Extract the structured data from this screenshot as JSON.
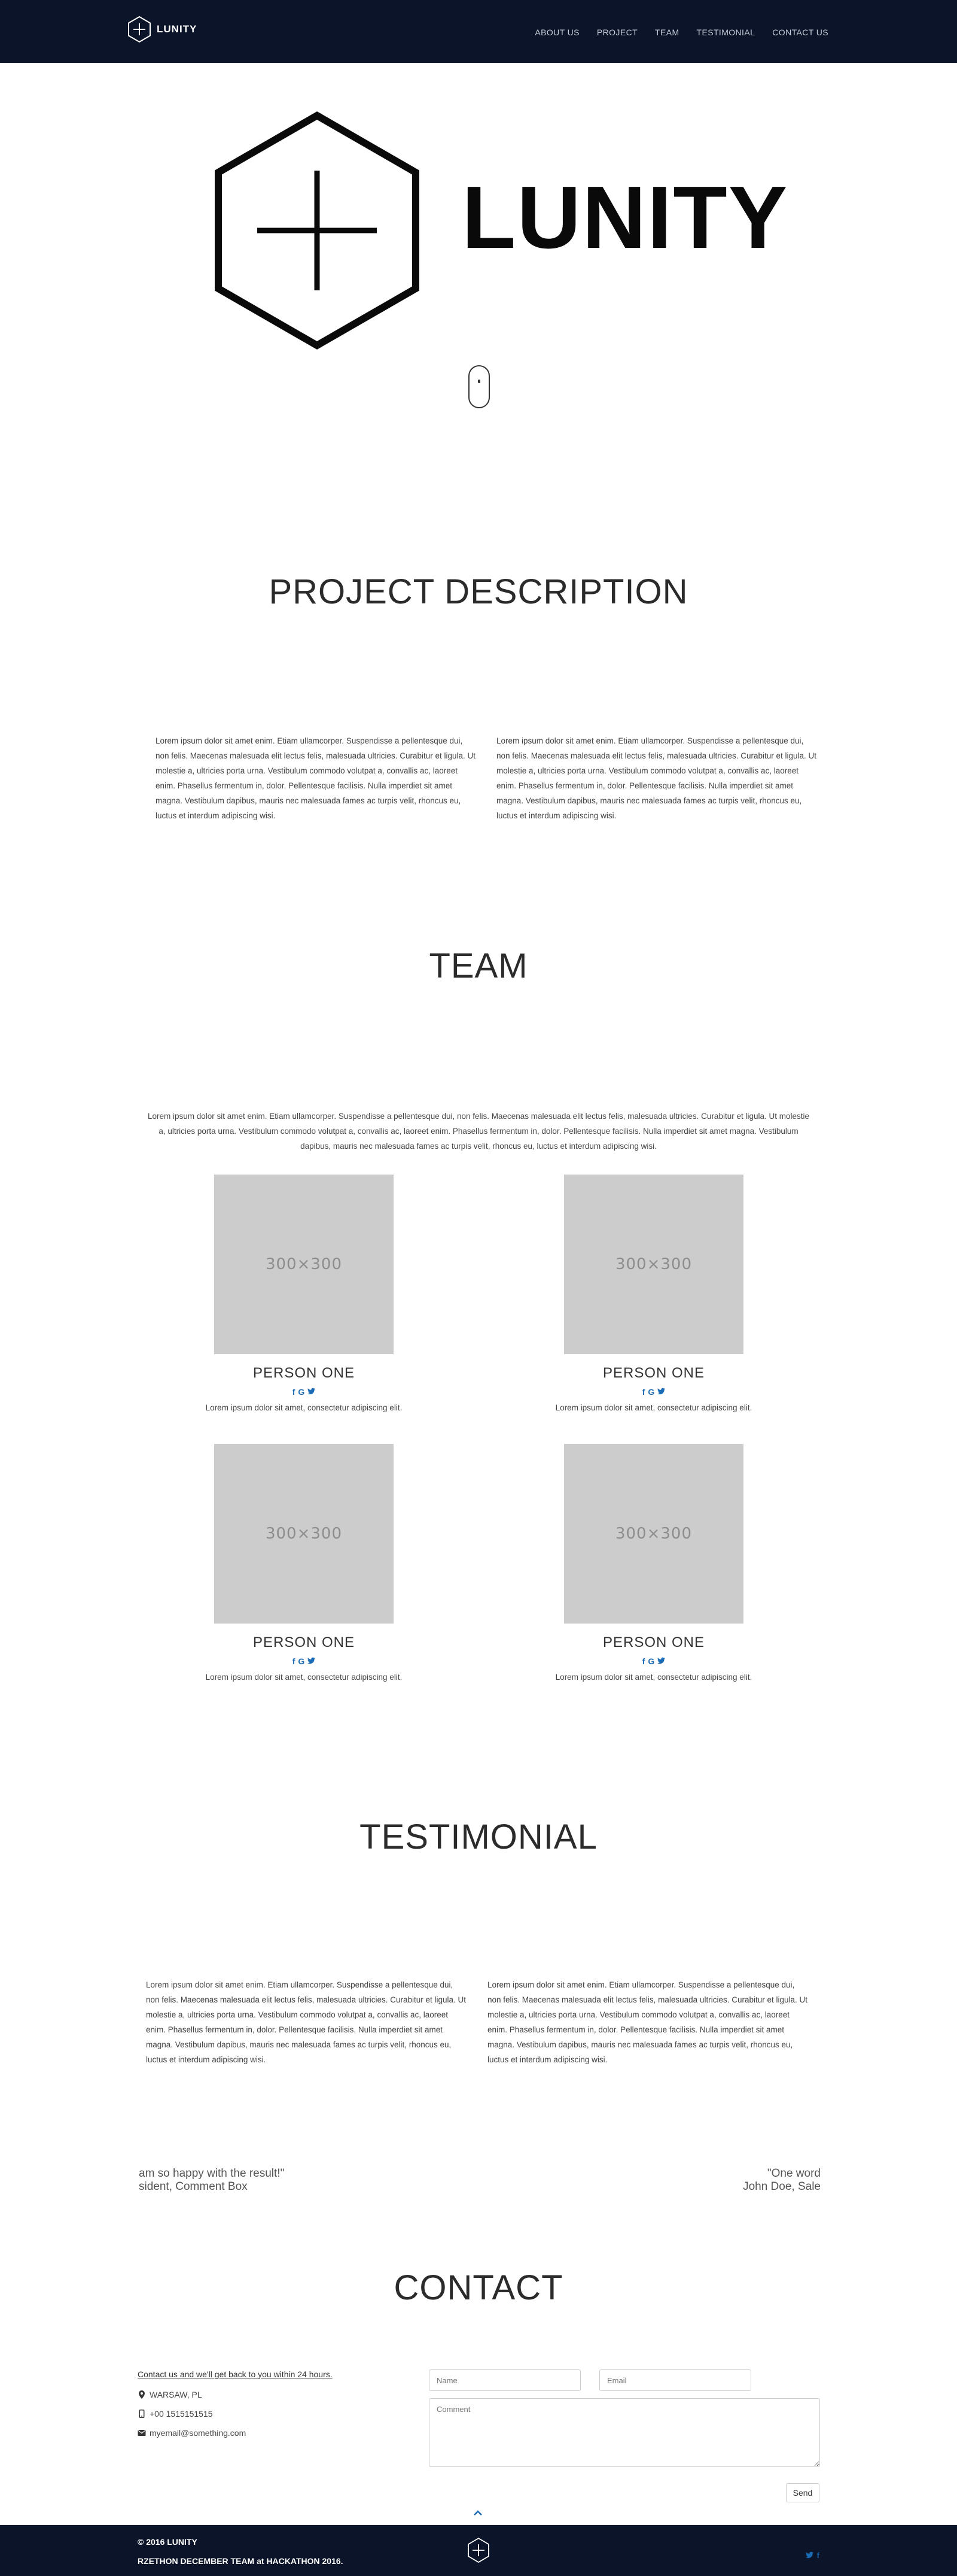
{
  "brand": {
    "name": "LUNITY"
  },
  "nav": {
    "items": [
      {
        "label": "ABOUT US"
      },
      {
        "label": "PROJECT"
      },
      {
        "label": "TEAM"
      },
      {
        "label": "TESTIMONIAL"
      },
      {
        "label": "CONTACT US"
      }
    ]
  },
  "hero": {
    "title": "LUNITY"
  },
  "project": {
    "title": "PROJECT DESCRIPTION",
    "col1": "Lorem ipsum dolor sit amet enim. Etiam ullamcorper. Suspendisse a pellentesque dui, non felis. Maecenas malesuada elit lectus felis, malesuada ultricies. Curabitur et ligula. Ut molestie a, ultricies porta urna. Vestibulum commodo volutpat a, convallis ac, laoreet enim. Phasellus fermentum in, dolor. Pellentesque facilisis. Nulla imperdiet sit amet magna. Vestibulum dapibus, mauris nec malesuada fames ac turpis velit, rhoncus eu, luctus et interdum adipiscing wisi.",
    "col2": "Lorem ipsum dolor sit amet enim. Etiam ullamcorper. Suspendisse a pellentesque dui, non felis. Maecenas malesuada elit lectus felis, malesuada ultricies. Curabitur et ligula. Ut molestie a, ultricies porta urna. Vestibulum commodo volutpat a, convallis ac, laoreet enim. Phasellus fermentum in, dolor. Pellentesque facilisis. Nulla imperdiet sit amet magna. Vestibulum dapibus, mauris nec malesuada fames ac turpis velit, rhoncus eu, luctus et interdum adipiscing wisi."
  },
  "team": {
    "title": "TEAM",
    "intro": "Lorem ipsum dolor sit amet enim. Etiam ullamcorper. Suspendisse a pellentesque dui, non felis. Maecenas malesuada elit lectus felis, malesuada ultricies. Curabitur et ligula. Ut molestie a, ultricies porta urna. Vestibulum commodo volutpat a, convallis ac, laoreet enim. Phasellus fermentum in, dolor. Pellentesque facilisis. Nulla imperdiet sit amet magna. Vestibulum dapibus, mauris nec malesuada fames ac turpis velit, rhoncus eu, luctus et interdum adipiscing wisi.",
    "members": [
      {
        "photo": "300×300",
        "name": "PERSON ONE",
        "desc": "Lorem ipsum dolor sit amet, consectetur adipiscing elit."
      },
      {
        "photo": "300×300",
        "name": "PERSON ONE",
        "desc": "Lorem ipsum dolor sit amet, consectetur adipiscing elit."
      },
      {
        "photo": "300×300",
        "name": "PERSON ONE",
        "desc": "Lorem ipsum dolor sit amet, consectetur adipiscing elit."
      },
      {
        "photo": "300×300",
        "name": "PERSON ONE",
        "desc": "Lorem ipsum dolor sit amet, consectetur adipiscing elit."
      }
    ],
    "social_icons": [
      "f",
      "G",
      "twitter-bird"
    ]
  },
  "testimonial": {
    "title": "TESTIMONIAL",
    "col1": "Lorem ipsum dolor sit amet enim. Etiam ullamcorper. Suspendisse a pellentesque dui, non felis. Maecenas malesuada elit lectus felis, malesuada ultricies. Curabitur et ligula. Ut molestie a, ultricies porta urna. Vestibulum commodo volutpat a, convallis ac, laoreet enim. Phasellus fermentum in, dolor. Pellentesque facilisis. Nulla imperdiet sit amet magna. Vestibulum dapibus, mauris nec malesuada fames ac turpis velit, rhoncus eu, luctus et interdum adipiscing wisi.",
    "col2": "Lorem ipsum dolor sit amet enim. Etiam ullamcorper. Suspendisse a pellentesque dui, non felis. Maecenas malesuada elit lectus felis, malesuada ultricies. Curabitur et ligula. Ut molestie a, ultricies porta urna. Vestibulum commodo volutpat a, convallis ac, laoreet enim. Phasellus fermentum in, dolor. Pellentesque facilisis. Nulla imperdiet sit amet magna. Vestibulum dapibus, mauris nec malesuada fames ac turpis velit, rhoncus eu, luctus et interdum adipiscing wisi.",
    "quote_left": "am so happy with the result!\"",
    "quote_left_author": "sident, Comment Box",
    "quote_right": "\"One word",
    "quote_right_author": "John Doe, Sale"
  },
  "contact": {
    "title": "CONTACT",
    "tagline": "Contact us and we'll get back to you within 24 hours.",
    "location": "WARSAW, PL",
    "phone": "+00 1515151515",
    "email": "myemail@something.com",
    "name_placeholder": "Name",
    "email_placeholder": "Email",
    "comment_placeholder": "Comment",
    "send_label": "Send"
  },
  "footer": {
    "copyright": "© 2016 LUNITY",
    "credit": "RZETHON DECEMBER TEAM at HACKATHON 2016."
  },
  "colors": {
    "nav_bg": "#0b1428",
    "link_blue": "#1a6bb5",
    "placeholder_gray": "#cccccc"
  }
}
